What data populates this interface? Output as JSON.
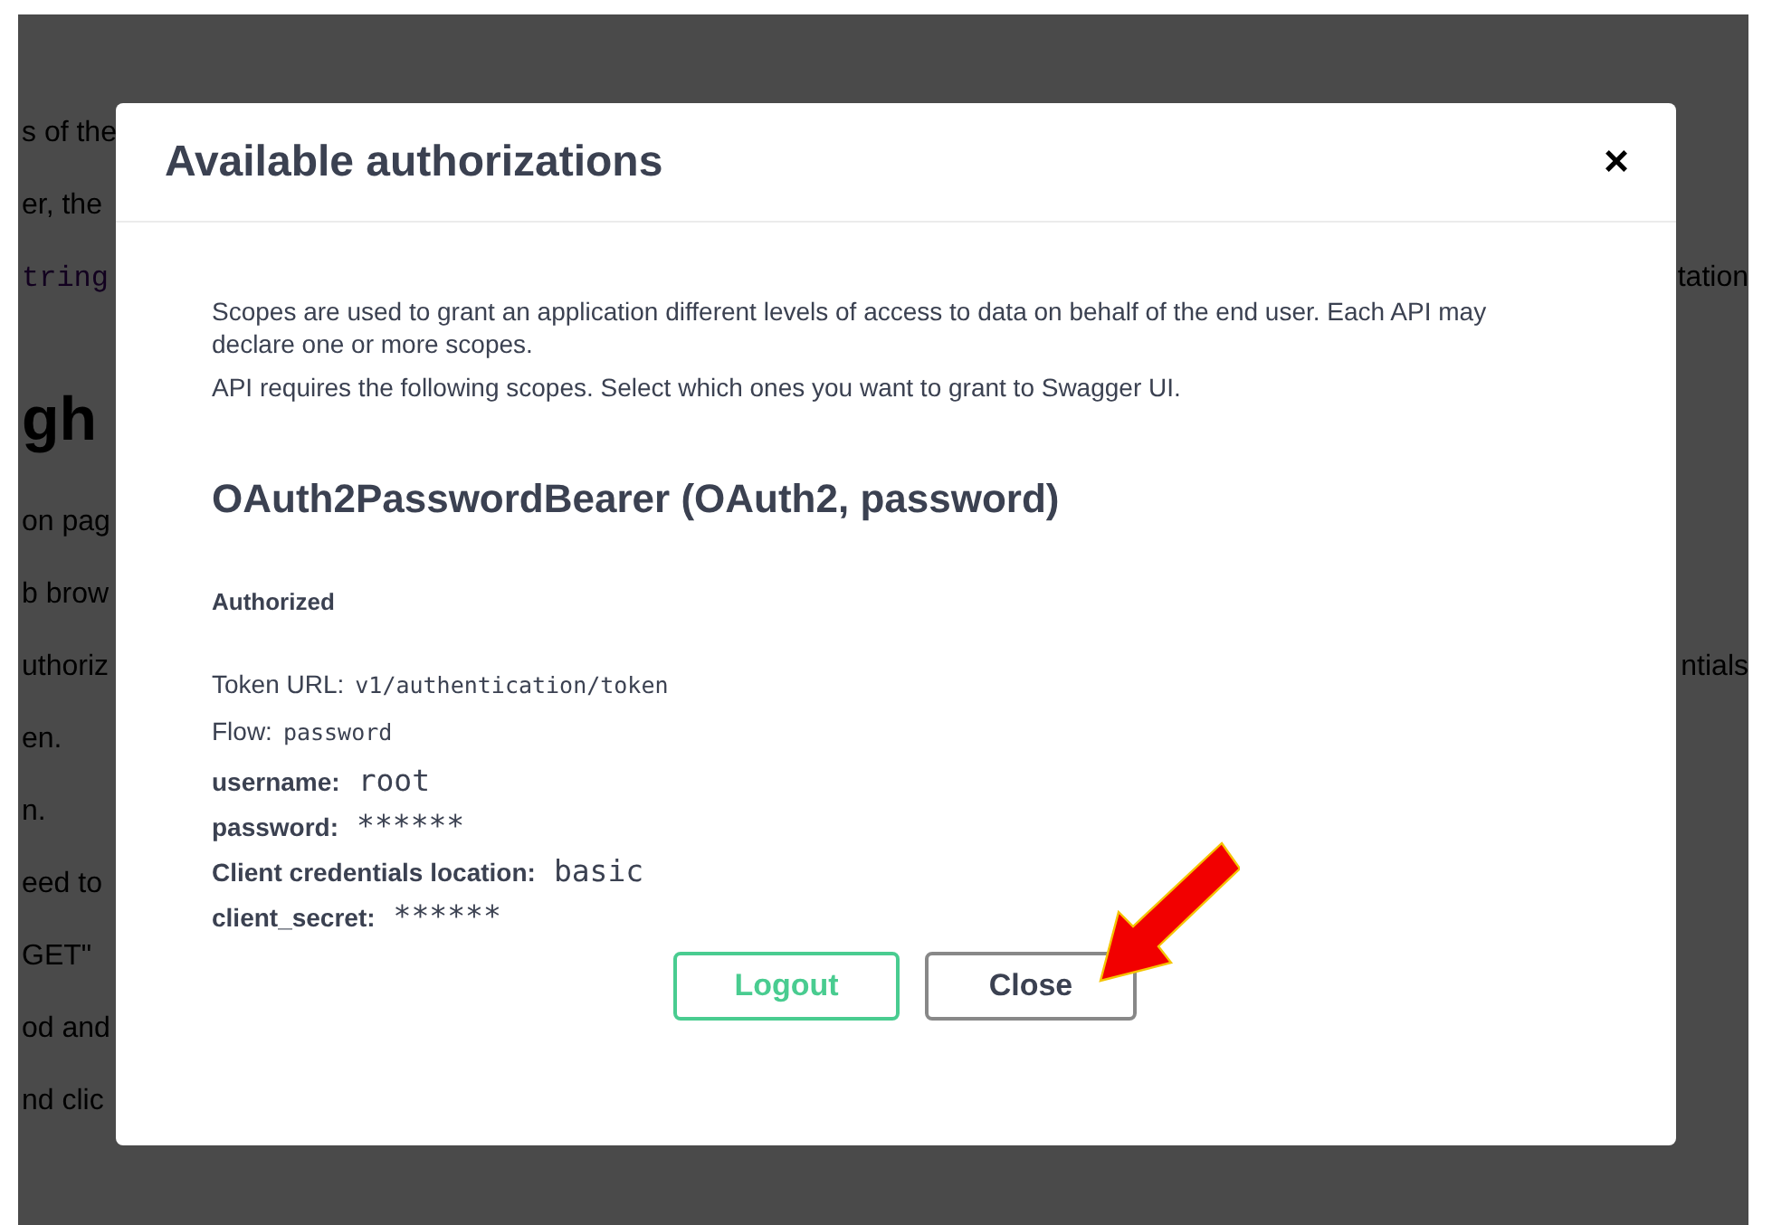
{
  "background_page": {
    "rows": [
      {
        "kind": "text",
        "left": "s of the"
      },
      {
        "kind": "text",
        "left": "er, the"
      },
      {
        "kind": "code",
        "left": "tring",
        "right": "tation"
      },
      {
        "kind": "heading",
        "left": "gh"
      },
      {
        "kind": "text",
        "left": "on pag"
      },
      {
        "kind": "text",
        "left": "b brow"
      },
      {
        "kind": "text",
        "left": "uthoriz",
        "right": "ntials"
      },
      {
        "kind": "text",
        "left": "en."
      },
      {
        "kind": "text",
        "left": "n."
      },
      {
        "kind": "text",
        "left": "eed to"
      },
      {
        "kind": "text",
        "left": "GET\""
      },
      {
        "kind": "text",
        "left": "od and"
      },
      {
        "kind": "text",
        "left": "nd clic"
      }
    ]
  },
  "modal": {
    "title": "Available authorizations",
    "close": "×",
    "description": [
      "Scopes are used to grant an application different levels of access to data on behalf of the end user. Each API may declare one or more scopes.",
      "API requires the following scopes. Select which ones you want to grant to Swagger UI."
    ],
    "scheme_title": "OAuth2PasswordBearer (OAuth2, password)",
    "status": "Authorized",
    "fields": [
      {
        "kind": "info",
        "label": "Token URL:",
        "value": "v1/authentication/token"
      },
      {
        "kind": "info",
        "label": "Flow:",
        "value": "password"
      },
      {
        "kind": "credential",
        "label": "username:",
        "value": "root"
      },
      {
        "kind": "credential",
        "label": "password:",
        "value": "******"
      },
      {
        "kind": "credential",
        "label": "Client credentials location:",
        "value": "basic"
      },
      {
        "kind": "credential",
        "label": "client_secret:",
        "value": "******"
      }
    ],
    "buttons": [
      {
        "kind": "logout",
        "label": "Logout"
      },
      {
        "kind": "close",
        "label": "Close"
      }
    ]
  }
}
